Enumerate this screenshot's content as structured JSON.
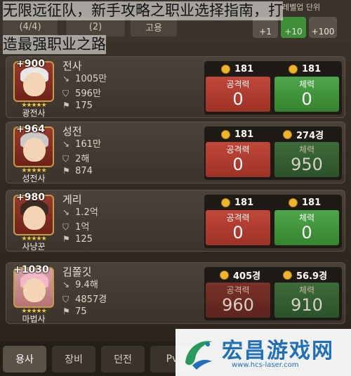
{
  "caption": {
    "line1": "无限远征队，新手攻略之职业选择指南，打",
    "line2": "造最强职业之路"
  },
  "topbar": {
    "party_count": "(4/4)",
    "partial_tab": "(2)",
    "upgrade": "고용",
    "increments": [
      "+1",
      "+10",
      "+100"
    ],
    "unit_label": "레벨업 단위"
  },
  "heroes": [
    {
      "level": "+900",
      "name": "전사",
      "job": "광전사",
      "stars": "★★★★★",
      "attack": "1005만",
      "defense": "596만",
      "flag": "175",
      "attack_cost": "181",
      "hp_cost": "181",
      "attack_label": "공격력",
      "hp_label": "체력",
      "attack_value": "0",
      "hp_value": "0"
    },
    {
      "level": "+964",
      "name": "성전",
      "job": "성전사",
      "stars": "★★★★★",
      "attack": "161만",
      "defense": "2해",
      "flag": "874",
      "attack_cost": "181",
      "hp_cost": "274경",
      "attack_label": "공격력",
      "hp_label": "체력",
      "attack_value": "0",
      "hp_value": "950"
    },
    {
      "level": "+980",
      "name": "게리",
      "job": "사냥꾼",
      "stars": "★★★★★",
      "attack": "1.2억",
      "defense": "1억",
      "flag": "125",
      "attack_cost": "181",
      "hp_cost": "181",
      "attack_label": "공격력",
      "hp_label": "체력",
      "attack_value": "0",
      "hp_value": "0"
    },
    {
      "level": "+1030",
      "name": "김쫄깃",
      "job": "마법사",
      "stars": "★★★★★",
      "attack": "9.4해",
      "defense": "4857경",
      "flag": "75",
      "attack_cost": "405경",
      "hp_cost": "56.9경",
      "attack_label": "공격력",
      "hp_label": "체력",
      "attack_value": "960",
      "hp_value": "910"
    }
  ],
  "tabs": [
    "용사",
    "장비",
    "던전",
    "Pv"
  ],
  "watermark": {
    "brand": "宏昌游戏网",
    "url": "www.hcs-laser.com"
  }
}
